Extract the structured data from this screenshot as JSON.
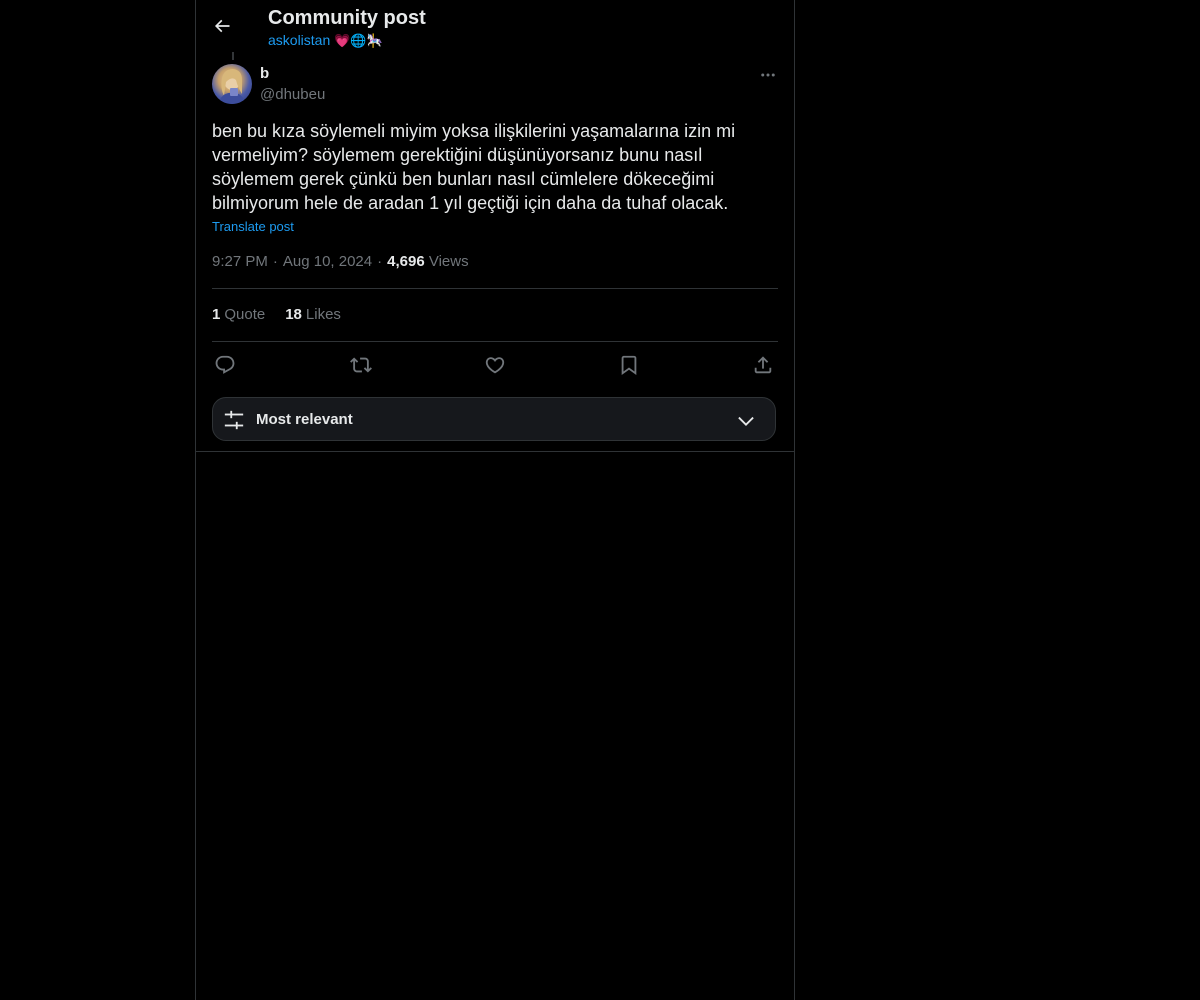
{
  "header": {
    "title": "Community post",
    "community_name": "askolistan",
    "community_emoji": "💗🌐🎠"
  },
  "post": {
    "author_name": "b",
    "author_handle": "@dhubeu",
    "text": "ben bu kıza söylemeli miyim yoksa ilişkilerini yaşamalarına izin mi\nvermeliyim? söylemem gerektiğini düşünüyorsanız bunu nasıl\nsöylemem gerek çünkü ben bunları nasıl cümlelere dökeceğimi\nbilmiyorum hele de aradan 1 yıl geçtiği için daha da tuhaf olacak.",
    "translate_label": "Translate post",
    "time": "9:27 PM",
    "separator": "·",
    "date": "Aug 10, 2024",
    "views_count": "4,696",
    "views_label": "Views"
  },
  "stats": {
    "quotes_count": "1",
    "quotes_label": "Quote",
    "likes_count": "18",
    "likes_label": "Likes"
  },
  "actions": [
    "reply-icon",
    "repost-icon",
    "like-icon",
    "bookmark-icon",
    "share-icon"
  ],
  "sort": {
    "label": "Most relevant"
  },
  "colors": {
    "background": "#000000",
    "text": "#e7e9ea",
    "muted": "#71767b",
    "accent": "#1d9bf0",
    "border": "#2f3336"
  }
}
